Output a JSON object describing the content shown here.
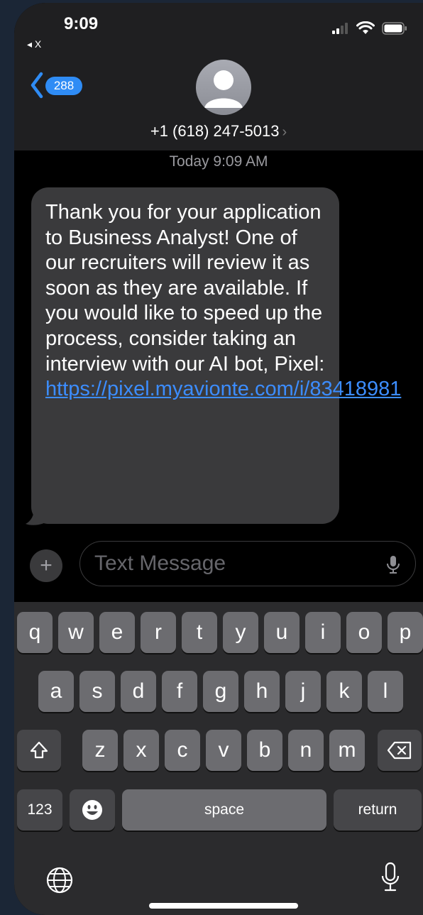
{
  "status": {
    "time": "9:09",
    "back_app": "◂ X"
  },
  "nav": {
    "unread_count": "288"
  },
  "contact": {
    "number": "+1 (618) 247-5013",
    "chevron": "›"
  },
  "thread": {
    "timestamp": "Today 9:09 AM"
  },
  "message": {
    "text": "Thank you for your application to Business Analyst! One of our recruiters will review it as soon as they are available. If you would like to speed up the process, consider taking an interview with our AI bot, Pixel: ",
    "link": "https://pixel.myavionte.com/i/83418981"
  },
  "composer": {
    "placeholder": "Text Message",
    "plus_label": "+"
  },
  "keyboard": {
    "row1": [
      "q",
      "w",
      "e",
      "r",
      "t",
      "y",
      "u",
      "i",
      "o",
      "p"
    ],
    "row2": [
      "a",
      "s",
      "d",
      "f",
      "g",
      "h",
      "j",
      "k",
      "l"
    ],
    "row3": [
      "z",
      "x",
      "c",
      "v",
      "b",
      "n",
      "m"
    ],
    "numbers_label": "123",
    "space_label": "space",
    "return_label": "return"
  },
  "colors": {
    "accent": "#2f8cf5",
    "link": "#3c8dff",
    "bubble": "#3a3a3c"
  }
}
